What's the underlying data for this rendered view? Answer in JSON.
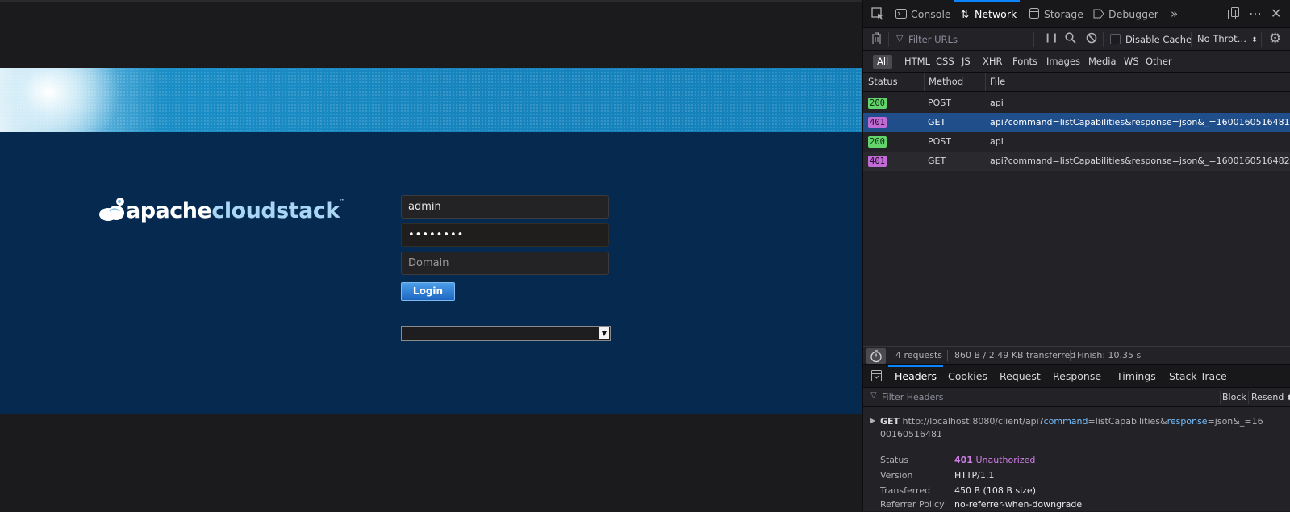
{
  "page": {
    "logo": {
      "part1": "apache",
      "part2": "cloudstack",
      "tm": "™"
    },
    "login_form": {
      "username_value": "admin",
      "password_value": "••••••••",
      "domain_placeholder": "Domain",
      "login_label": "Login",
      "locale_value": ""
    }
  },
  "devtools": {
    "tabs": [
      {
        "label": "Console",
        "icon": "console-icon"
      },
      {
        "label": "Network",
        "icon": "network-icon",
        "selected": true
      },
      {
        "label": "Storage",
        "icon": "storage-icon"
      },
      {
        "label": "Debugger",
        "icon": "debugger-icon"
      }
    ],
    "toolbar": {
      "filter_placeholder": "Filter URLs",
      "disable_cache_label": "Disable Cache",
      "throttle_label": "No Throt…"
    },
    "filter_types": [
      "All",
      "HTML",
      "CSS",
      "JS",
      "XHR",
      "Fonts",
      "Images",
      "Media",
      "WS",
      "Other"
    ],
    "columns": {
      "status": "Status",
      "method": "Method",
      "file": "File"
    },
    "requests": [
      {
        "status": "200",
        "method": "POST",
        "file": "api"
      },
      {
        "status": "401",
        "method": "GET",
        "file": "api?command=listCapabilities&response=json&_=1600160516481"
      },
      {
        "status": "200",
        "method": "POST",
        "file": "api"
      },
      {
        "status": "401",
        "method": "GET",
        "file": "api?command=listCapabilities&response=json&_=1600160516482"
      }
    ],
    "summary": {
      "requests": "4 requests",
      "transferred": "860 B / 2.49 KB transferred",
      "finish": "Finish: 10.35 s"
    },
    "detail_tabs": [
      "Headers",
      "Cookies",
      "Request",
      "Response",
      "Timings",
      "Stack Trace"
    ],
    "headers_panel": {
      "filter_placeholder": "Filter Headers",
      "block_label": "Block",
      "resend_label": "Resend",
      "request_method": "GET",
      "url_base": "http://localhost:8080/client/api?",
      "url_key1": "command",
      "url_eq1": "=listCapabilities&",
      "url_key2": "response",
      "url_rest": "=json&_=1600160516481",
      "rows": [
        {
          "key": "Status",
          "code": "401",
          "value": "Unauthorized"
        },
        {
          "key": "Version",
          "value": "HTTP/1.1"
        },
        {
          "key": "Transferred",
          "value": "450 B (108 B size)"
        },
        {
          "key": "Referrer Policy",
          "value": "no-referrer-when-downgrade"
        }
      ]
    }
  }
}
